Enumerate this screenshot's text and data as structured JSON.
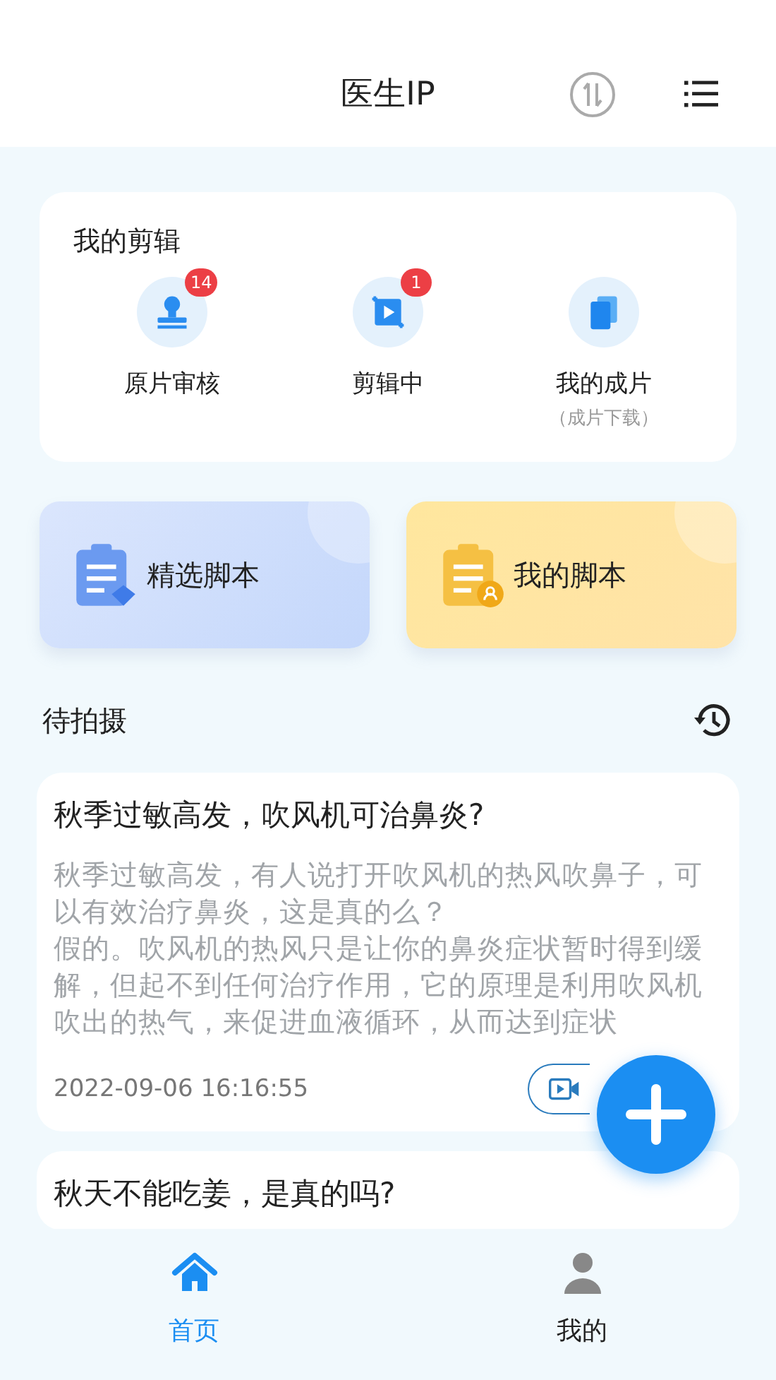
{
  "header": {
    "title": "医生IP"
  },
  "my_edits": {
    "title": "我的剪辑",
    "items": [
      {
        "kind": "review",
        "label": "原片审核",
        "badge": "14"
      },
      {
        "kind": "editing",
        "label": "剪辑中",
        "badge": "1"
      },
      {
        "kind": "finished",
        "label": "我的成片",
        "sublabel": "（成片下载）"
      }
    ]
  },
  "script_buttons": [
    {
      "kind": "featured",
      "label": "精选脚本"
    },
    {
      "kind": "mine",
      "label": "我的脚本"
    }
  ],
  "pending": {
    "title": "待拍摄",
    "items": [
      {
        "title": "秋季过敏高发，吹风机可治鼻炎?",
        "body": [
          "秋季过敏高发，有人说打开吹风机的热风吹鼻子，可以有效治疗鼻炎，这是真的么？",
          "假的。吹风机的热风只是让你的鼻炎症状暂时得到缓解，但起不到任何治疗作用，它的原理是利用吹风机吹出的热气，来促进血液循环，从而达到症状"
        ],
        "time": "2022-09-06 16:16:55"
      },
      {
        "title": "秋天不能吃姜，是真的吗?"
      }
    ]
  },
  "tabs": [
    {
      "kind": "home",
      "label": "首页",
      "selected": true
    },
    {
      "kind": "mine",
      "label": "我的",
      "selected": false
    }
  ]
}
